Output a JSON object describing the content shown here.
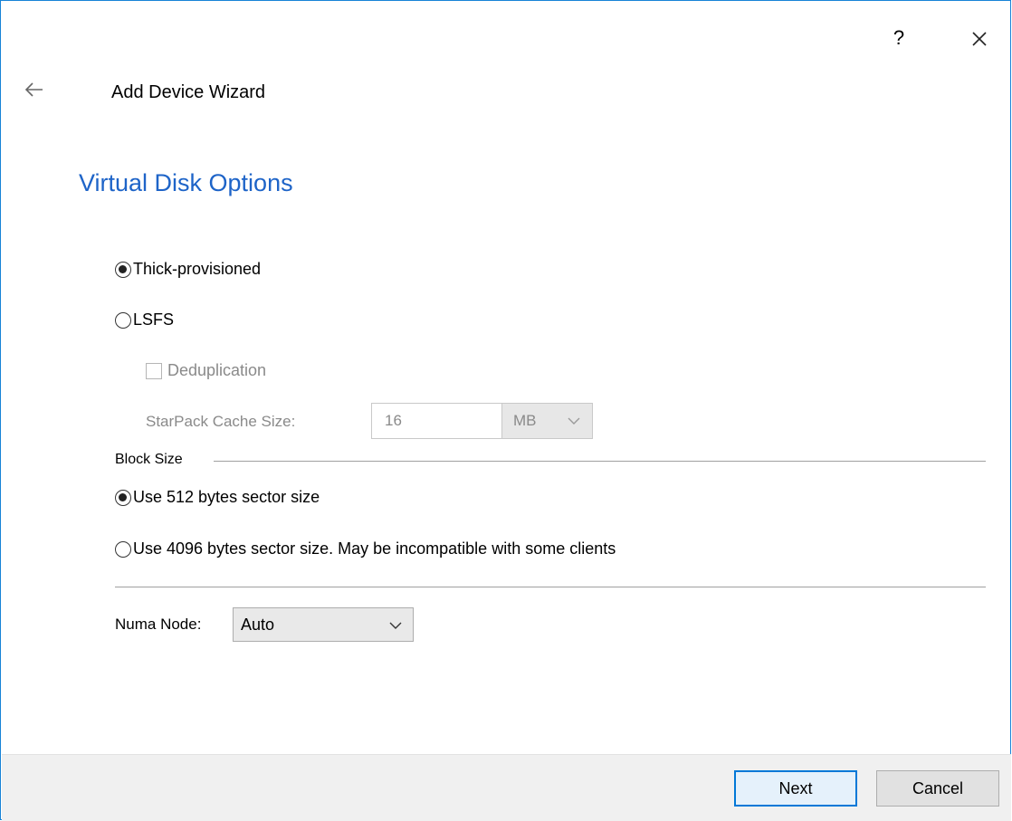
{
  "titlebar": {
    "help_label": "?",
    "close_icon": "close-icon"
  },
  "header": {
    "back_icon": "arrow-left-icon",
    "wizard_title": "Add Device Wizard"
  },
  "page": {
    "title": "Virtual Disk Options"
  },
  "provisioning": {
    "options": [
      {
        "label": "Thick-provisioned",
        "selected": true
      },
      {
        "label": "LSFS",
        "selected": false
      }
    ],
    "deduplication": {
      "label": "Deduplication",
      "checked": false,
      "enabled": false
    },
    "starpack_cache": {
      "label": "StarPack Cache Size:",
      "value": "16",
      "unit": "MB",
      "enabled": false
    }
  },
  "block_size": {
    "group_label": "Block Size",
    "options": [
      {
        "label": "Use 512 bytes sector size",
        "selected": true
      },
      {
        "label": "Use 4096 bytes sector size. May be incompatible with some clients",
        "selected": false
      }
    ]
  },
  "numa": {
    "label": "Numa Node:",
    "value": "Auto"
  },
  "footer": {
    "next_label": "Next",
    "cancel_label": "Cancel"
  },
  "colors": {
    "accent": "#1e64c8",
    "window_border": "#1883d7",
    "default_button_border": "#0078d7",
    "disabled_text": "#8a8a8a"
  }
}
